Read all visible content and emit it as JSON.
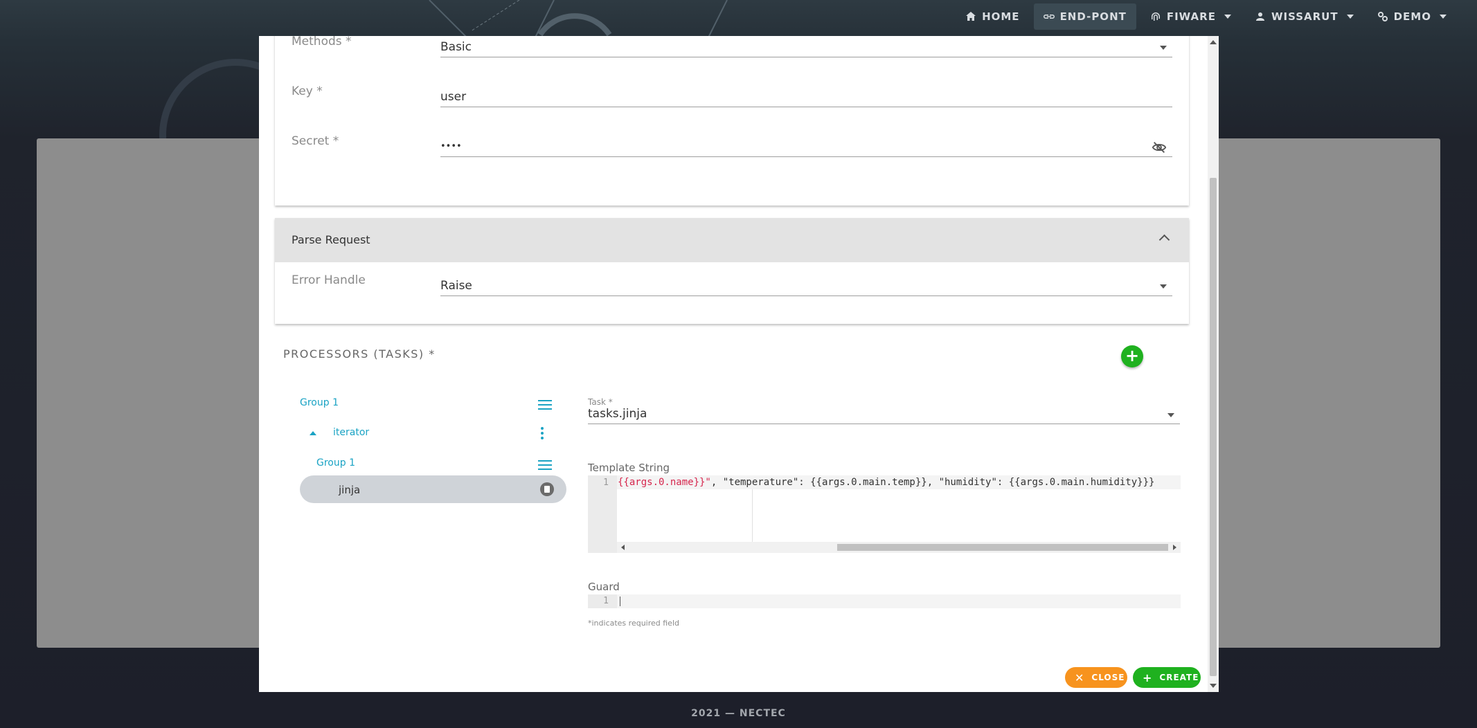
{
  "nav": {
    "items": [
      {
        "label": "HOME",
        "icon": "home-icon"
      },
      {
        "label": "END-PONT",
        "icon": "link-icon"
      },
      {
        "label": "FIWARE",
        "icon": "fingerprint-icon"
      },
      {
        "label": "WISSARUT",
        "icon": "user-icon"
      },
      {
        "label": "DEMO",
        "icon": "settings-icon"
      }
    ]
  },
  "auth": {
    "methods_label": "Methods *",
    "methods_value": "Basic",
    "key_label": "Key *",
    "key_value": "user",
    "secret_label": "Secret *",
    "secret_value": "••••"
  },
  "parse_request": {
    "title": "Parse Request",
    "error_handle_label": "Error Handle",
    "error_handle_value": "Raise"
  },
  "processors": {
    "title": "PROCESSORS (TASKS) *",
    "add_label": "+",
    "tree": {
      "group1": "Group 1",
      "iterator": "iterator",
      "inner_group": "Group 1",
      "selected": "jinja"
    },
    "task_label": "Task *",
    "task_value": "tasks.jinja",
    "template_label": "Template String",
    "template_line_no": "1",
    "template_red": "{{args.0.name}}\"",
    "template_rest": ", \"temperature\": {{args.0.main.temp}}, \"humidity\": {{args.0.main.humidity}}}",
    "guard_label": "Guard",
    "guard_line_no": "1",
    "required_hint": "*indicates required field"
  },
  "actions": {
    "close": "CLOSE",
    "create": "CREATE"
  },
  "footer": "2021 — NECTEC"
}
